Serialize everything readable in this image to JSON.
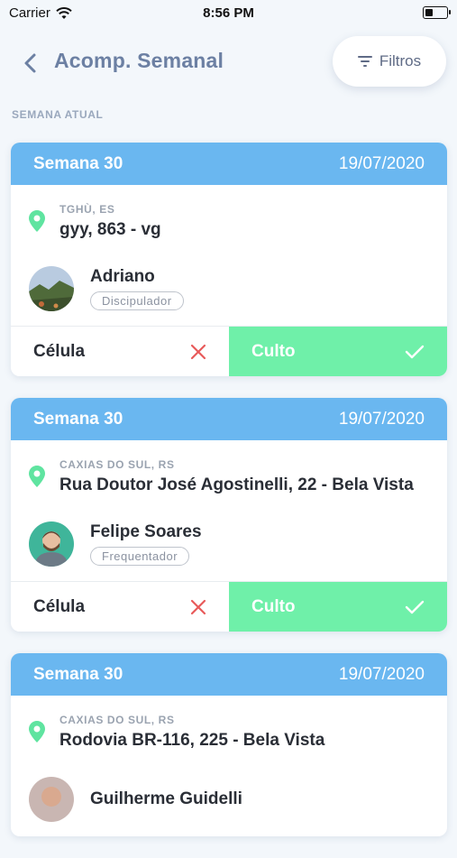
{
  "status_bar": {
    "carrier": "Carrier",
    "time": "8:56 PM"
  },
  "header": {
    "title": "Acomp. Semanal",
    "filter_label": "Filtros"
  },
  "section": {
    "label": "SEMANA ATUAL"
  },
  "colors": {
    "header_blue": "#6ab7f0",
    "accent_green": "#6ff0a9",
    "x_red": "#e85a5a",
    "pin_green": "#5fe4a0"
  },
  "cards": [
    {
      "week": "Semana 30",
      "date": "19/07/2020",
      "city": "TGHÙ, ES",
      "street": "gyy, 863 - vg",
      "person_name": "Adriano",
      "role": "Discipulador",
      "left_label": "Célula",
      "left_icon": "x-icon",
      "right_label": "Culto",
      "right_icon": "check-icon"
    },
    {
      "week": "Semana 30",
      "date": "19/07/2020",
      "city": "CAXIAS DO SUL, RS",
      "street": "Rua Doutor José Agostinelli, 22 - Bela Vista",
      "person_name": "Felipe Soares",
      "role": "Frequentador",
      "left_label": "Célula",
      "left_icon": "x-icon",
      "right_label": "Culto",
      "right_icon": "check-icon"
    },
    {
      "week": "Semana 30",
      "date": "19/07/2020",
      "city": "CAXIAS DO SUL, RS",
      "street": "Rodovia BR-116, 225 - Bela Vista",
      "person_name": "Guilherme Guidelli"
    }
  ]
}
